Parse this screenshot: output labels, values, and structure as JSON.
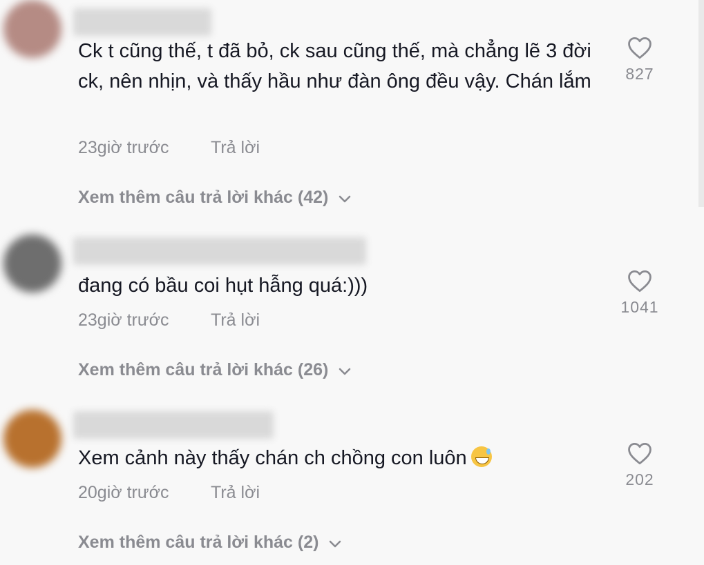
{
  "comments": [
    {
      "text": "Ck t cũng thế, t đã bỏ, ck sau cũng thế, mà chẳng lẽ 3 đời ck, nên nhịn, và thấy hầu như đàn ông đều vậy. Chán lắm",
      "time": "23giờ trước",
      "reply_label": "Trả lời",
      "likes": "827",
      "more_replies": "Xem thêm câu trả lời khác (42)",
      "avatar_color": "#b58b84"
    },
    {
      "text": "đang có bầu coi hụt hẫng quá:)))",
      "time": "23giờ trước",
      "reply_label": "Trả lời",
      "likes": "1041",
      "more_replies": "Xem thêm câu trả lời khác (26)",
      "avatar_color": "#6e6e6e"
    },
    {
      "text": "Xem cảnh này thấy chán ch chồng con luôn",
      "emoji": "grinning-sweat-emoji",
      "time": "20giờ trước",
      "reply_label": "Trả lời",
      "likes": "202",
      "more_replies": "Xem thêm câu trả lời khác (2)",
      "avatar_color": "#b8712e"
    }
  ],
  "icons": {
    "like": "heart-outline-icon",
    "expand": "chevron-down-icon"
  },
  "colors": {
    "background": "#f8f8f8",
    "text": "#161823",
    "secondary": "#8a8b91"
  }
}
